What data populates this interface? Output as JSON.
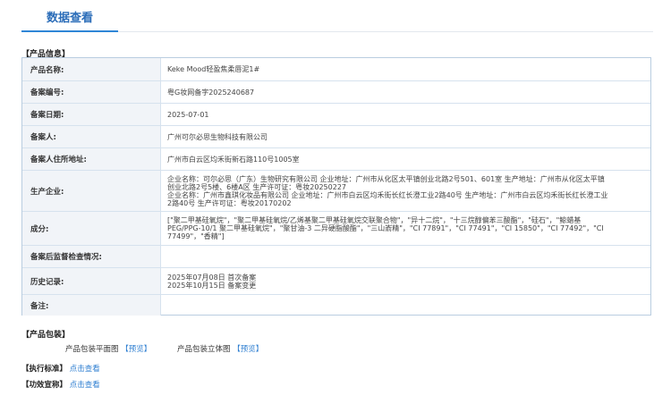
{
  "tab": {
    "label": "数据查看"
  },
  "product_info": {
    "title": "【产品信息】",
    "rows": [
      {
        "label": "产品名称:",
        "value": "Keke Mood轻盈焦柔唇泥1#"
      },
      {
        "label": "备案编号:",
        "value": "粤G妆网备字2025240687"
      },
      {
        "label": "备案日期:",
        "value": "2025-07-01"
      },
      {
        "label": "备案人:",
        "value": "广州可尔必思生物科技有限公司"
      },
      {
        "label": "备案人住所地址:",
        "value": "广州市白云区均禾街新石路110号1005室"
      },
      {
        "label": "生产企业:",
        "lines": [
          "企业名称：可尔必思（广东）生物研究有限公司 企业地址：广州市从化区太平镇创业北路2号501、601室 生产地址：广州市从化区太平镇",
          "创业北路2号5楼、6楼A区 生产许可证：粤妆20250227",
          "企业名称：广州市鑫琪化妆品有限公司 企业地址：广州市白云区均禾街长红长澄工业2路40号 生产地址：广州市白云区均禾街长红长澄工业",
          "2路40号 生产许可证：粤妆20170202"
        ]
      },
      {
        "label": "成分:",
        "lines": [
          "[\"聚二甲基硅氧烷\"，\"聚二甲基硅氧烷/乙烯基聚二甲基硅氧烷交联聚合物\"，\"异十二烷\"，\"十三烷醇偏苯三酸酯\"，\"硅石\"，\"鲸蜡基",
          "PEG/PPG-10/1 聚二甲基硅氧烷\"，\"聚甘油-3 二异硬脂酸酯\"，\"三山嵛精\"，\"CI 77891\"，\"CI 77491\"，\"CI 15850\"，\"CI 77492\"，\"CI",
          "77499\"，\"香精\"]"
        ]
      },
      {
        "label": "备案后监督检查情况:",
        "value": ""
      },
      {
        "label": "历史记录:",
        "lines": [
          "2025年07月08日 首次备案",
          "2025年10月15日 备案变更"
        ]
      },
      {
        "label": "备注:",
        "value": ""
      }
    ]
  },
  "packaging": {
    "title": "【产品包装】",
    "flat_label": "产品包装平面图",
    "flat_link": "【预览】",
    "solid_label": "产品包装立体图",
    "solid_link": "【预览】"
  },
  "standard": {
    "title": "【执行标准】",
    "link": "点击查看"
  },
  "efficacy": {
    "title": "【功效宣称】",
    "link": "点击查看"
  }
}
